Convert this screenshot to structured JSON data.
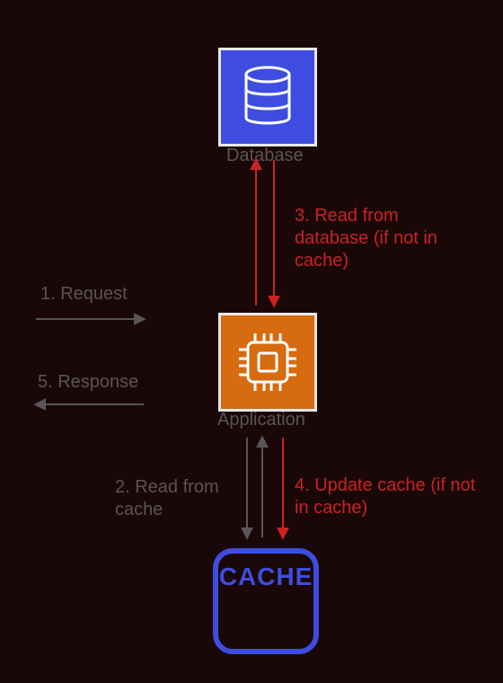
{
  "nodes": {
    "database": {
      "label": "Database"
    },
    "application": {
      "label": "Application"
    },
    "cache": {
      "label": "CACHE"
    }
  },
  "steps": {
    "s1": "1. Request",
    "s2": "2. Read from cache",
    "s3": "3. Read from database (if not in cache)",
    "s4": "4. Update cache (if not in cache)",
    "s5": "5. Response"
  },
  "colors": {
    "bg": "#1a0808",
    "node_blue": "#3e4de0",
    "node_orange": "#d66b0f",
    "text_muted": "#595457",
    "text_red": "#cc2222",
    "border_light": "#e8e8e8"
  }
}
